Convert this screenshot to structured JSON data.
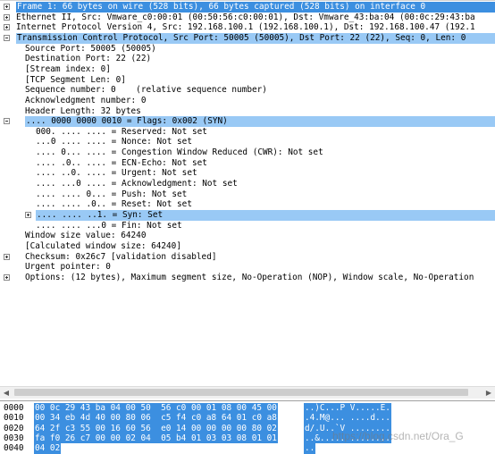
{
  "tree": {
    "rows": [
      {
        "text": "Frame 1: 66 bytes on wire (528 bits), 66 bytes captured (528 bits) on interface 0",
        "indent": 0,
        "expander": "plus",
        "style": "dark"
      },
      {
        "text": "Ethernet II, Src: Vmware_c0:00:01 (00:50:56:c0:00:01), Dst: Vmware_43:ba:04 (00:0c:29:43:ba",
        "indent": 0,
        "expander": "plus",
        "style": ""
      },
      {
        "text": "Internet Protocol Version 4, Src: 192.168.100.1 (192.168.100.1), Dst: 192.168.100.47 (192.1",
        "indent": 0,
        "expander": "plus",
        "style": ""
      },
      {
        "text": "Transmission Control Protocol, Src Port: 50005 (50005), Dst Port: 22 (22), Seq: 0, Len: 0",
        "indent": 0,
        "expander": "minus",
        "style": "light"
      },
      {
        "text": "Source Port: 50005 (50005)",
        "indent": 1,
        "expander": "",
        "style": ""
      },
      {
        "text": "Destination Port: 22 (22)",
        "indent": 1,
        "expander": "",
        "style": ""
      },
      {
        "text": "[Stream index: 0]",
        "indent": 1,
        "expander": "",
        "style": ""
      },
      {
        "text": "[TCP Segment Len: 0]",
        "indent": 1,
        "expander": "",
        "style": ""
      },
      {
        "text": "Sequence number: 0    (relative sequence number)",
        "indent": 1,
        "expander": "",
        "style": ""
      },
      {
        "text": "Acknowledgment number: 0",
        "indent": 1,
        "expander": "",
        "style": ""
      },
      {
        "text": "Header Length: 32 bytes",
        "indent": 1,
        "expander": "",
        "style": ""
      },
      {
        "text": ".... 0000 0000 0010 = Flags: 0x002 (SYN)",
        "indent": 1,
        "expander": "minus",
        "style": "light"
      },
      {
        "text": "000. .... .... = Reserved: Not set",
        "indent": 2,
        "expander": "",
        "style": ""
      },
      {
        "text": "...0 .... .... = Nonce: Not set",
        "indent": 2,
        "expander": "",
        "style": ""
      },
      {
        "text": ".... 0... .... = Congestion Window Reduced (CWR): Not set",
        "indent": 2,
        "expander": "",
        "style": ""
      },
      {
        "text": ".... .0.. .... = ECN-Echo: Not set",
        "indent": 2,
        "expander": "",
        "style": ""
      },
      {
        "text": ".... ..0. .... = Urgent: Not set",
        "indent": 2,
        "expander": "",
        "style": ""
      },
      {
        "text": ".... ...0 .... = Acknowledgment: Not set",
        "indent": 2,
        "expander": "",
        "style": ""
      },
      {
        "text": ".... .... 0... = Push: Not set",
        "indent": 2,
        "expander": "",
        "style": ""
      },
      {
        "text": ".... .... .0.. = Reset: Not set",
        "indent": 2,
        "expander": "",
        "style": ""
      },
      {
        "text": ".... .... ..1. = Syn: Set",
        "indent": 2,
        "expander": "plus",
        "style": "light"
      },
      {
        "text": ".... .... ...0 = Fin: Not set",
        "indent": 2,
        "expander": "",
        "style": ""
      },
      {
        "text": "Window size value: 64240",
        "indent": 1,
        "expander": "",
        "style": ""
      },
      {
        "text": "[Calculated window size: 64240]",
        "indent": 1,
        "expander": "",
        "style": ""
      },
      {
        "text": "Checksum: 0x26c7 [validation disabled]",
        "indent": 1,
        "expander": "plus",
        "style": ""
      },
      {
        "text": "Urgent pointer: 0",
        "indent": 1,
        "expander": "",
        "style": ""
      },
      {
        "text": "Options: (12 bytes), Maximum segment size, No-Operation (NOP), Window scale, No-Operation",
        "indent": 1,
        "expander": "plus",
        "style": ""
      }
    ]
  },
  "scrollbar": {
    "left_arrow": "◀",
    "right_arrow": "▶"
  },
  "hex": {
    "rows": [
      {
        "offset": "0000",
        "bytes": "00 0c 29 43 ba 04 00 50  56 c0 00 01 08 00 45 00",
        "ascii": "..)C...P V.....E."
      },
      {
        "offset": "0010",
        "bytes": "00 34 eb 4d 40 00 80 06  c5 f4 c0 a8 64 01 c0 a8",
        "ascii": ".4.M@... ....d..."
      },
      {
        "offset": "0020",
        "bytes": "64 2f c3 55 00 16 60 56  e0 14 00 00 00 00 80 02",
        "ascii": "d/.U..`V ........"
      },
      {
        "offset": "0030",
        "bytes": "fa f0 26 c7 00 00 02 04  05 b4 01 03 03 08 01 01",
        "ascii": "..&..... ........"
      },
      {
        "offset": "0040",
        "bytes": "04 02",
        "ascii": ".."
      }
    ]
  },
  "watermark": "https://blog.csdn.net/Ora_G"
}
